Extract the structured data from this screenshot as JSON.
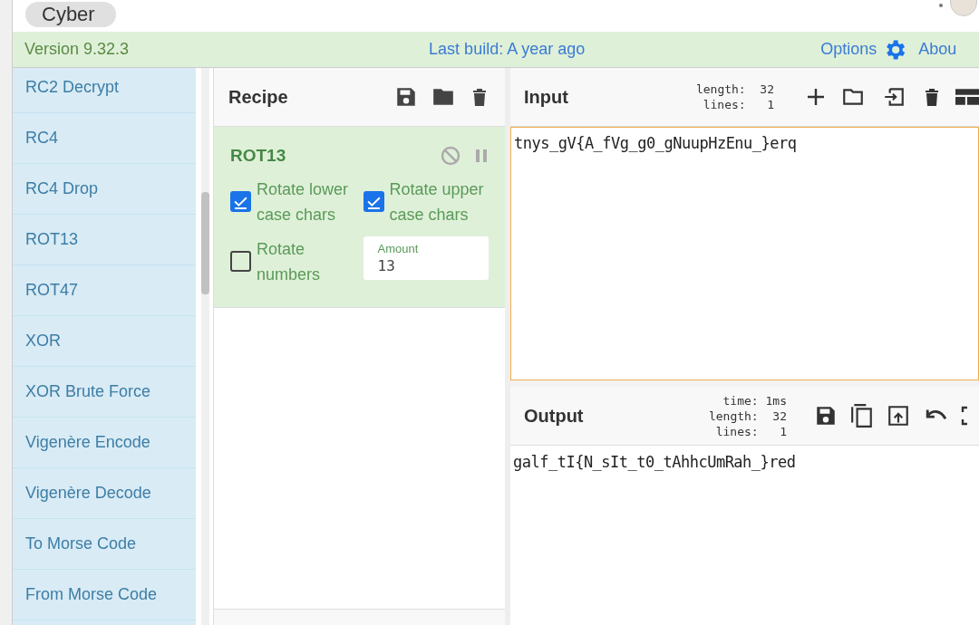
{
  "top_button": {
    "label": "Cyber"
  },
  "banner": {
    "version": "Version 9.32.3",
    "last_build": "Last build: A year ago",
    "options": "Options",
    "about": "Abou"
  },
  "operations": [
    {
      "label": "RC2 Decrypt"
    },
    {
      "label": "RC4"
    },
    {
      "label": "RC4 Drop"
    },
    {
      "label": "ROT13"
    },
    {
      "label": "ROT47"
    },
    {
      "label": "XOR"
    },
    {
      "label": "XOR Brute Force"
    },
    {
      "label": "Vigenère Encode"
    },
    {
      "label": "Vigenère Decode"
    },
    {
      "label": "To Morse Code"
    },
    {
      "label": "From Morse Code"
    }
  ],
  "recipe": {
    "title": "Recipe",
    "operation": {
      "name": "ROT13",
      "args": [
        {
          "kind": "checkbox",
          "label": "Rotate lower case chars",
          "checked": true
        },
        {
          "kind": "checkbox",
          "label": "Rotate upper case chars",
          "checked": true
        },
        {
          "kind": "checkbox",
          "label": "Rotate numbers",
          "checked": false
        },
        {
          "kind": "number",
          "label": "Amount",
          "value": "13"
        }
      ]
    }
  },
  "input": {
    "title": "Input",
    "stats": [
      {
        "label": "length:",
        "value": "32"
      },
      {
        "label": "lines:",
        "value": "1"
      }
    ],
    "text": "tnys_gV{A_fVg_g0_gNuupHzEnu_}erq"
  },
  "output": {
    "title": "Output",
    "stats": [
      {
        "label": "time:",
        "value": "1ms"
      },
      {
        "label": "length:",
        "value": "32"
      },
      {
        "label": "lines:",
        "value": "1"
      }
    ],
    "text": "galf_tI{N_sIt_t0_tAhhcUmRah_}red"
  }
}
